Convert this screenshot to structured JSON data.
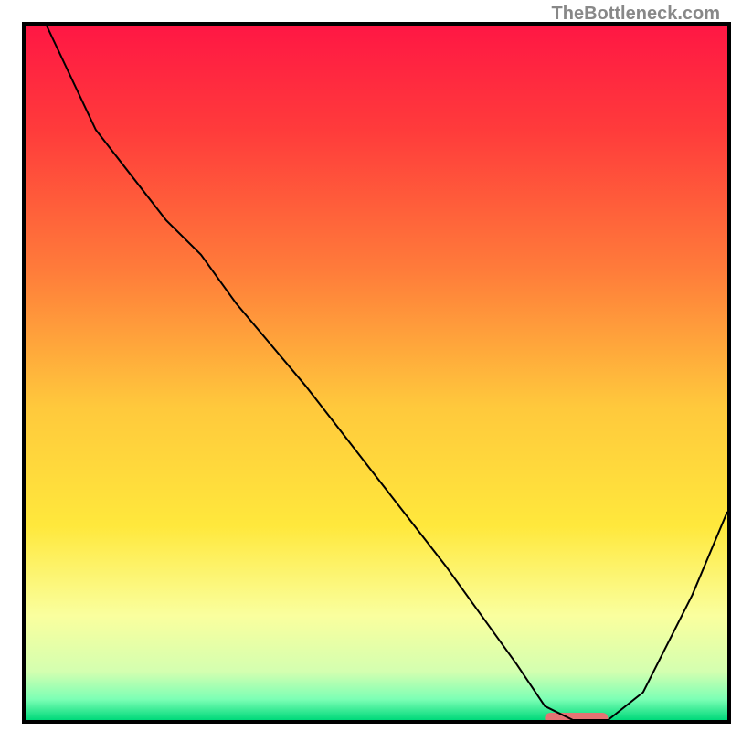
{
  "watermark": "TheBottleneck.com",
  "chart_data": {
    "type": "line",
    "title": "",
    "xlabel": "",
    "ylabel": "",
    "xlim": [
      0,
      100
    ],
    "ylim": [
      0,
      100
    ],
    "background": {
      "type": "vertical-gradient",
      "stops": [
        {
          "offset": 0.0,
          "color": "#ff1744"
        },
        {
          "offset": 0.15,
          "color": "#ff3b3b"
        },
        {
          "offset": 0.35,
          "color": "#ff7b3a"
        },
        {
          "offset": 0.55,
          "color": "#ffc93c"
        },
        {
          "offset": 0.72,
          "color": "#ffe83c"
        },
        {
          "offset": 0.85,
          "color": "#faff9e"
        },
        {
          "offset": 0.93,
          "color": "#d4ffb0"
        },
        {
          "offset": 0.97,
          "color": "#7cffb5"
        },
        {
          "offset": 1.0,
          "color": "#00d97a"
        }
      ]
    },
    "series": [
      {
        "name": "bottleneck-curve",
        "color": "#000000",
        "stroke_width": 2,
        "x": [
          3,
          10,
          20,
          25,
          30,
          40,
          50,
          60,
          70,
          74,
          78,
          83,
          88,
          95,
          100
        ],
        "y": [
          100,
          85,
          72,
          67,
          60,
          48,
          35,
          22,
          8,
          2,
          0,
          0,
          4,
          18,
          30
        ]
      }
    ],
    "marker": {
      "name": "highlight-segment",
      "color": "#e57373",
      "x_start": 74,
      "x_end": 83,
      "thickness": 12
    },
    "axes": {
      "color": "#000000",
      "width": 4
    }
  }
}
